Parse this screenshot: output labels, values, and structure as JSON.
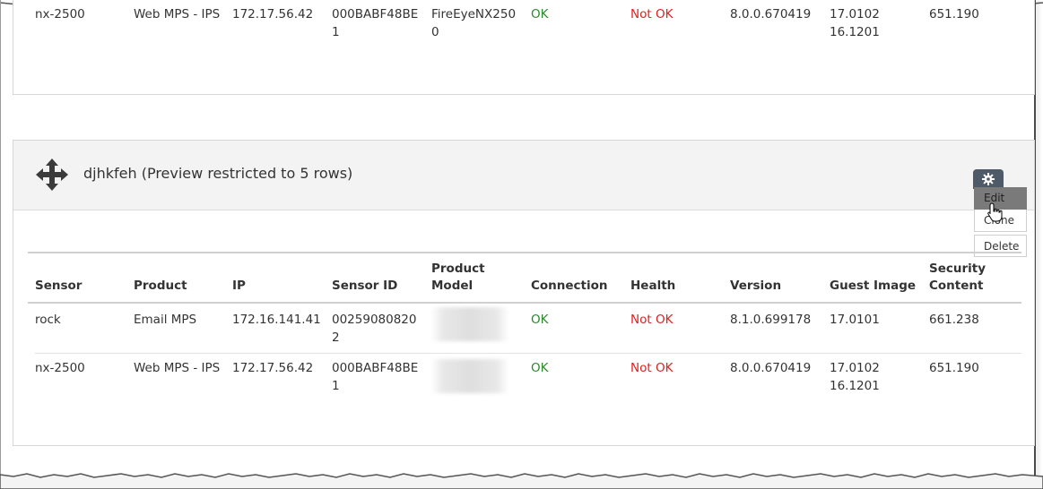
{
  "top_row": {
    "sensor": "nx-2500",
    "product": "Web MPS - IPS",
    "ip": "172.17.56.42",
    "sensor_id": "000BABF48BE1",
    "product_model": "FireEyeNX2500",
    "connection": "OK",
    "health": "Not OK",
    "version": "8.0.0.670419",
    "guest_image_1": "17.0102",
    "guest_image_2": "16.1201",
    "security_content": "651.190"
  },
  "panel": {
    "title": "djhkfeh (Preview restricted to 5 rows)",
    "menu": {
      "edit": "Edit",
      "clone": "Clone",
      "delete": "Delete"
    }
  },
  "table": {
    "headers": {
      "sensor": "Sensor",
      "product": "Product",
      "ip": "IP",
      "sensor_id": "Sensor ID",
      "product_model_1": "Product",
      "product_model_2": "Model",
      "connection": "Connection",
      "health": "Health",
      "version": "Version",
      "guest_image": "Guest Image",
      "security_content_1": "Security",
      "security_content_2": "Content"
    },
    "rows": [
      {
        "sensor": "rock",
        "product": "Email MPS",
        "ip": "172.16.141.41",
        "sensor_id": "002590808202",
        "connection": "OK",
        "health": "Not OK",
        "version": "8.1.0.699178",
        "guest_image_1": "17.0101",
        "guest_image_2": "",
        "security_content": "661.238"
      },
      {
        "sensor": "nx-2500",
        "product": "Web MPS - IPS",
        "ip": "172.17.56.42",
        "sensor_id": "000BABF48BE1",
        "connection": "OK",
        "health": "Not OK",
        "version": "8.0.0.670419",
        "guest_image_1": "17.0102",
        "guest_image_2": "16.1201",
        "security_content": "651.190"
      }
    ]
  },
  "colors": {
    "ok": "#2a8a2a",
    "not_ok": "#e02020",
    "gear_button": "#4e5a67",
    "menu_active": "#7a7a7a"
  },
  "icons": {
    "move": "move-arrows-icon",
    "gear": "gear-icon",
    "cursor": "hand-pointer-icon"
  }
}
